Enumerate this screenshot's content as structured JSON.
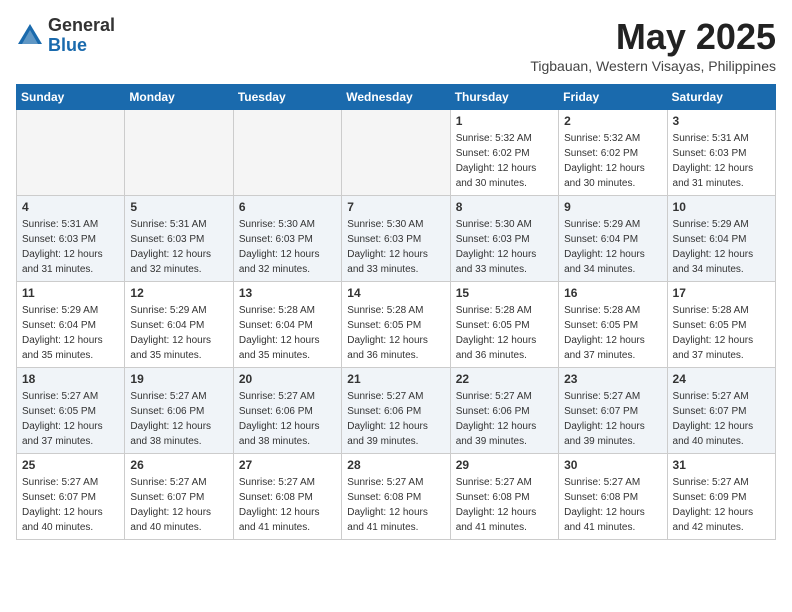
{
  "header": {
    "logo_general": "General",
    "logo_blue": "Blue",
    "month_title": "May 2025",
    "location": "Tigbauan, Western Visayas, Philippines"
  },
  "weekdays": [
    "Sunday",
    "Monday",
    "Tuesday",
    "Wednesday",
    "Thursday",
    "Friday",
    "Saturday"
  ],
  "weeks": [
    [
      {
        "day": "",
        "info": ""
      },
      {
        "day": "",
        "info": ""
      },
      {
        "day": "",
        "info": ""
      },
      {
        "day": "",
        "info": ""
      },
      {
        "day": "1",
        "info": "Sunrise: 5:32 AM\nSunset: 6:02 PM\nDaylight: 12 hours\nand 30 minutes."
      },
      {
        "day": "2",
        "info": "Sunrise: 5:32 AM\nSunset: 6:02 PM\nDaylight: 12 hours\nand 30 minutes."
      },
      {
        "day": "3",
        "info": "Sunrise: 5:31 AM\nSunset: 6:03 PM\nDaylight: 12 hours\nand 31 minutes."
      }
    ],
    [
      {
        "day": "4",
        "info": "Sunrise: 5:31 AM\nSunset: 6:03 PM\nDaylight: 12 hours\nand 31 minutes."
      },
      {
        "day": "5",
        "info": "Sunrise: 5:31 AM\nSunset: 6:03 PM\nDaylight: 12 hours\nand 32 minutes."
      },
      {
        "day": "6",
        "info": "Sunrise: 5:30 AM\nSunset: 6:03 PM\nDaylight: 12 hours\nand 32 minutes."
      },
      {
        "day": "7",
        "info": "Sunrise: 5:30 AM\nSunset: 6:03 PM\nDaylight: 12 hours\nand 33 minutes."
      },
      {
        "day": "8",
        "info": "Sunrise: 5:30 AM\nSunset: 6:03 PM\nDaylight: 12 hours\nand 33 minutes."
      },
      {
        "day": "9",
        "info": "Sunrise: 5:29 AM\nSunset: 6:04 PM\nDaylight: 12 hours\nand 34 minutes."
      },
      {
        "day": "10",
        "info": "Sunrise: 5:29 AM\nSunset: 6:04 PM\nDaylight: 12 hours\nand 34 minutes."
      }
    ],
    [
      {
        "day": "11",
        "info": "Sunrise: 5:29 AM\nSunset: 6:04 PM\nDaylight: 12 hours\nand 35 minutes."
      },
      {
        "day": "12",
        "info": "Sunrise: 5:29 AM\nSunset: 6:04 PM\nDaylight: 12 hours\nand 35 minutes."
      },
      {
        "day": "13",
        "info": "Sunrise: 5:28 AM\nSunset: 6:04 PM\nDaylight: 12 hours\nand 35 minutes."
      },
      {
        "day": "14",
        "info": "Sunrise: 5:28 AM\nSunset: 6:05 PM\nDaylight: 12 hours\nand 36 minutes."
      },
      {
        "day": "15",
        "info": "Sunrise: 5:28 AM\nSunset: 6:05 PM\nDaylight: 12 hours\nand 36 minutes."
      },
      {
        "day": "16",
        "info": "Sunrise: 5:28 AM\nSunset: 6:05 PM\nDaylight: 12 hours\nand 37 minutes."
      },
      {
        "day": "17",
        "info": "Sunrise: 5:28 AM\nSunset: 6:05 PM\nDaylight: 12 hours\nand 37 minutes."
      }
    ],
    [
      {
        "day": "18",
        "info": "Sunrise: 5:27 AM\nSunset: 6:05 PM\nDaylight: 12 hours\nand 37 minutes."
      },
      {
        "day": "19",
        "info": "Sunrise: 5:27 AM\nSunset: 6:06 PM\nDaylight: 12 hours\nand 38 minutes."
      },
      {
        "day": "20",
        "info": "Sunrise: 5:27 AM\nSunset: 6:06 PM\nDaylight: 12 hours\nand 38 minutes."
      },
      {
        "day": "21",
        "info": "Sunrise: 5:27 AM\nSunset: 6:06 PM\nDaylight: 12 hours\nand 39 minutes."
      },
      {
        "day": "22",
        "info": "Sunrise: 5:27 AM\nSunset: 6:06 PM\nDaylight: 12 hours\nand 39 minutes."
      },
      {
        "day": "23",
        "info": "Sunrise: 5:27 AM\nSunset: 6:07 PM\nDaylight: 12 hours\nand 39 minutes."
      },
      {
        "day": "24",
        "info": "Sunrise: 5:27 AM\nSunset: 6:07 PM\nDaylight: 12 hours\nand 40 minutes."
      }
    ],
    [
      {
        "day": "25",
        "info": "Sunrise: 5:27 AM\nSunset: 6:07 PM\nDaylight: 12 hours\nand 40 minutes."
      },
      {
        "day": "26",
        "info": "Sunrise: 5:27 AM\nSunset: 6:07 PM\nDaylight: 12 hours\nand 40 minutes."
      },
      {
        "day": "27",
        "info": "Sunrise: 5:27 AM\nSunset: 6:08 PM\nDaylight: 12 hours\nand 41 minutes."
      },
      {
        "day": "28",
        "info": "Sunrise: 5:27 AM\nSunset: 6:08 PM\nDaylight: 12 hours\nand 41 minutes."
      },
      {
        "day": "29",
        "info": "Sunrise: 5:27 AM\nSunset: 6:08 PM\nDaylight: 12 hours\nand 41 minutes."
      },
      {
        "day": "30",
        "info": "Sunrise: 5:27 AM\nSunset: 6:08 PM\nDaylight: 12 hours\nand 41 minutes."
      },
      {
        "day": "31",
        "info": "Sunrise: 5:27 AM\nSunset: 6:09 PM\nDaylight: 12 hours\nand 42 minutes."
      }
    ]
  ]
}
